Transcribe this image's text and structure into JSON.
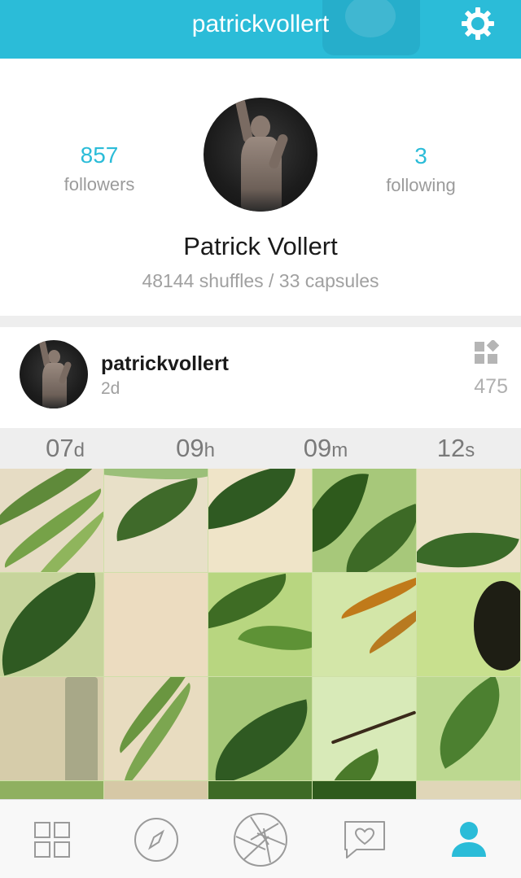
{
  "header": {
    "title": "patrickvollert",
    "settings_icon": "gear-icon"
  },
  "profile": {
    "followers_count": "857",
    "followers_label": "followers",
    "following_count": "3",
    "following_label": "following",
    "name": "Patrick Vollert",
    "stats_line": "48144 shuffles / 33 capsules"
  },
  "post": {
    "username": "patrickvollert",
    "time": "2d",
    "capsule_icon": "capsules-icon",
    "capsule_count": "475",
    "countdown": [
      {
        "num": "07",
        "unit": "d"
      },
      {
        "num": "09",
        "unit": "h"
      },
      {
        "num": "09",
        "unit": "m"
      },
      {
        "num": "12",
        "unit": "s"
      }
    ]
  },
  "tabbar": {
    "items": [
      {
        "icon": "grid-icon",
        "active": false
      },
      {
        "icon": "compass-icon",
        "active": false
      },
      {
        "icon": "aperture-icon",
        "active": false
      },
      {
        "icon": "heart-message-icon",
        "active": false
      },
      {
        "icon": "profile-icon",
        "active": true
      }
    ],
    "active_color": "#2bbcd8",
    "inactive_color": "#9a9a9a"
  },
  "colors": {
    "accent": "#2bbcd8",
    "muted_text": "#a0a0a0"
  }
}
